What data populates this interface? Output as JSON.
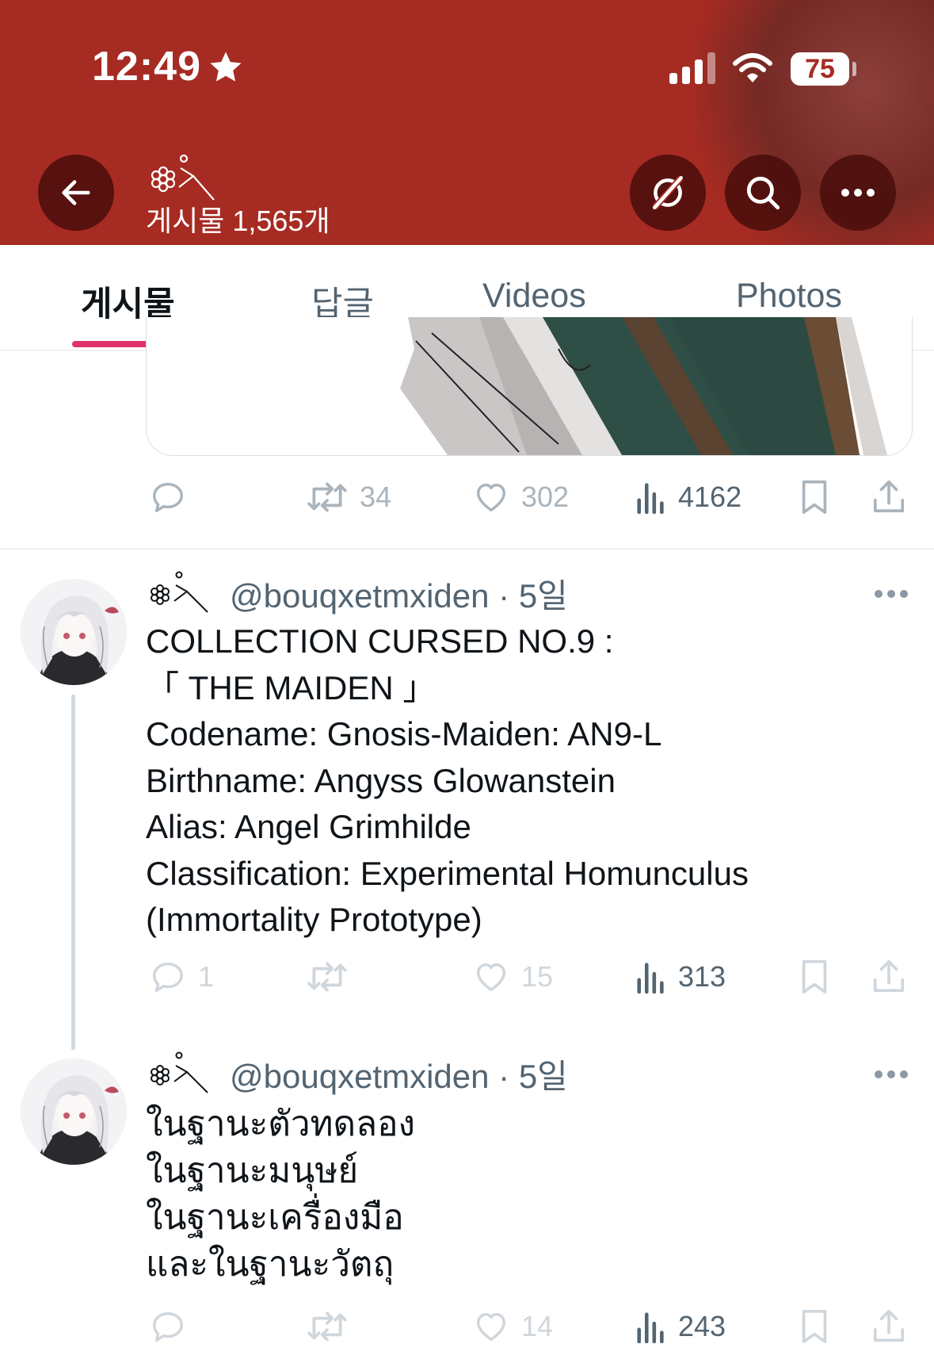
{
  "status_bar": {
    "time": "12:49",
    "battery": "75"
  },
  "header": {
    "profile_mark": "❁˚⟍",
    "post_count": "게시물 1,565개"
  },
  "tabs": [
    {
      "label": "게시물",
      "active": true
    },
    {
      "label": "답글",
      "active": false
    },
    {
      "label": "Videos",
      "active": false
    },
    {
      "label": "Photos",
      "active": false
    }
  ],
  "top_post_actions": {
    "replies": "",
    "reposts": "34",
    "likes": "302",
    "views": "4162"
  },
  "tweets": [
    {
      "handle": "@bouqxetmxiden · 5일",
      "lines": [
        "COLLECTION CURSED NO.9 :",
        "「 THE MAIDEN 」",
        "Codename: Gnosis-Maiden: AN9-L",
        "Birthname: Angyss Glowanstein",
        "Alias: Angel Grimhilde",
        "Classification: Experimental Homunculus",
        "(Immortality Prototype)"
      ],
      "replies": "1",
      "reposts": "",
      "likes": "15",
      "views": "313"
    },
    {
      "handle": "@bouqxetmxiden · 5일",
      "lines": [
        "ในฐานะตัวทดลอง",
        "ในฐานะมนุษย์",
        "ในฐานะเครื่องมือ",
        "และในฐานะวัตถุ"
      ],
      "replies": "",
      "reposts": "",
      "likes": "14",
      "views": "243"
    }
  ],
  "colors": {
    "header_bg": "#a62b22",
    "tab_indicator": "#e0336e",
    "muted_text": "#536471",
    "faded_icon": "#aab4bc"
  },
  "icons": [
    "back-arrow-icon",
    "grok-icon",
    "search-icon",
    "more-icon",
    "reply-icon",
    "repost-icon",
    "like-icon",
    "views-icon",
    "bookmark-icon",
    "share-icon"
  ]
}
